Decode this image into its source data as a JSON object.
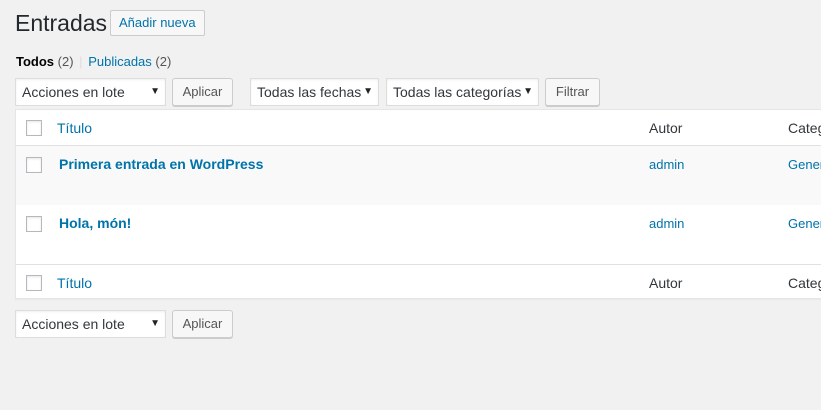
{
  "header": {
    "title": "Entradas",
    "add_new_label": "Añadir nueva"
  },
  "filters": {
    "all_label": "Todos",
    "all_count": "(2)",
    "separator": "|",
    "published_label": "Publicadas",
    "published_count": "(2)"
  },
  "toolbar_top": {
    "bulk_actions": "Acciones en lote",
    "apply": "Aplicar",
    "dates": "Todas las fechas",
    "categories": "Todas las categorías",
    "filter": "Filtrar"
  },
  "table": {
    "columns": {
      "title": "Título",
      "author": "Autor",
      "categories": "Categ"
    },
    "rows": [
      {
        "title": "Primera entrada en WordPress",
        "author": "admin",
        "category": "Gener"
      },
      {
        "title": "Hola, món!",
        "author": "admin",
        "category": "Gener"
      }
    ]
  },
  "toolbar_bottom": {
    "bulk_actions": "Acciones en lote",
    "apply": "Aplicar"
  },
  "colors": {
    "background": "#f1f1f1",
    "link": "#0073aa",
    "text": "#23282d"
  },
  "icons": {
    "dropdown": "triangle-down"
  }
}
